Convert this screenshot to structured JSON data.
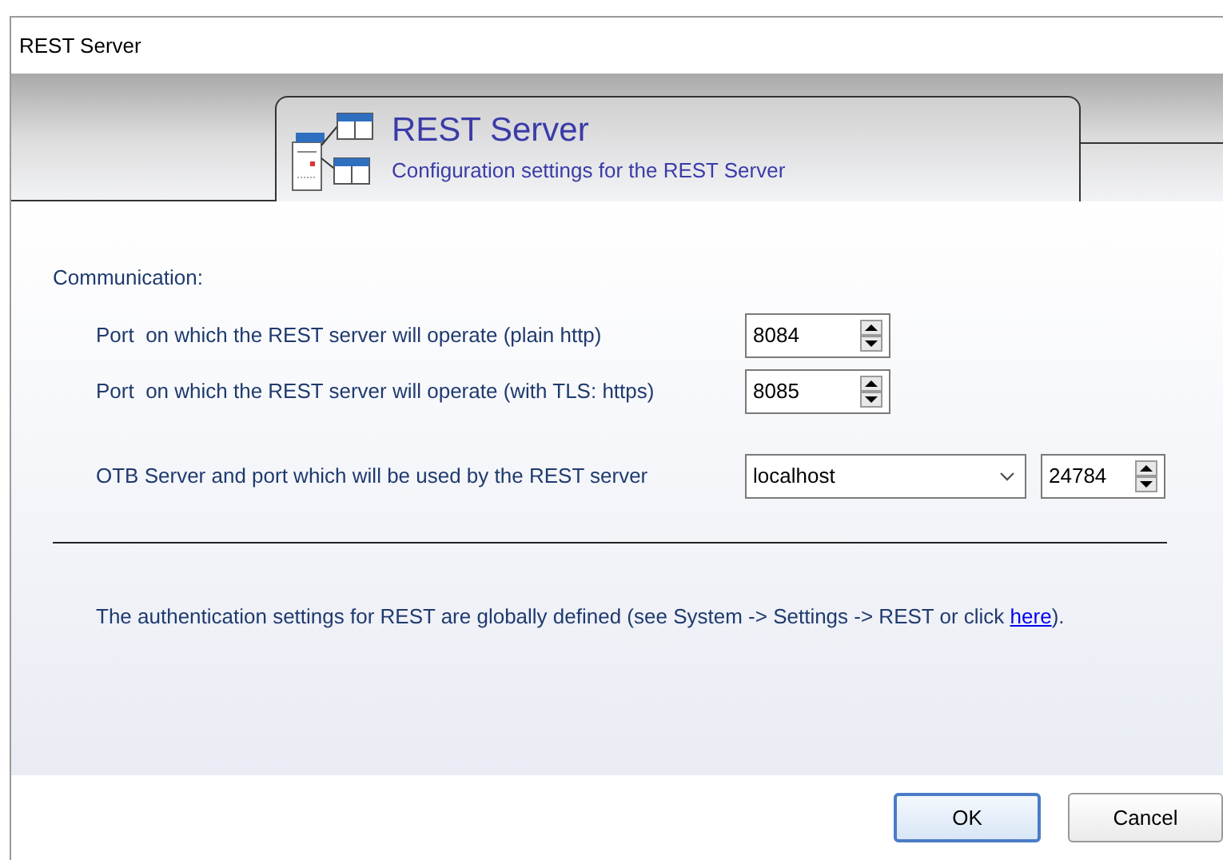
{
  "window": {
    "title": "REST Server"
  },
  "header": {
    "title": "REST Server",
    "subtitle": "Configuration settings for the REST Server"
  },
  "section": {
    "title": "Communication:"
  },
  "rows": [
    {
      "kind": "spinner",
      "label": "Port  on which the REST server will operate (plain http)",
      "value": "8084"
    },
    {
      "kind": "spinner",
      "label": "Port  on which the REST server will operate (with TLS: https)",
      "value": "8085"
    },
    {
      "kind": "combo",
      "label": "OTB Server and port which will be used by the REST server",
      "value": "localhost",
      "port": "24784"
    }
  ],
  "info": {
    "before": "The authentication settings for REST are globally defined (see System -> Settings -> REST or click ",
    "link": "here",
    "after": ")."
  },
  "buttons": [
    {
      "label": "OK",
      "default": true
    },
    {
      "label": "Cancel",
      "default": false
    }
  ]
}
